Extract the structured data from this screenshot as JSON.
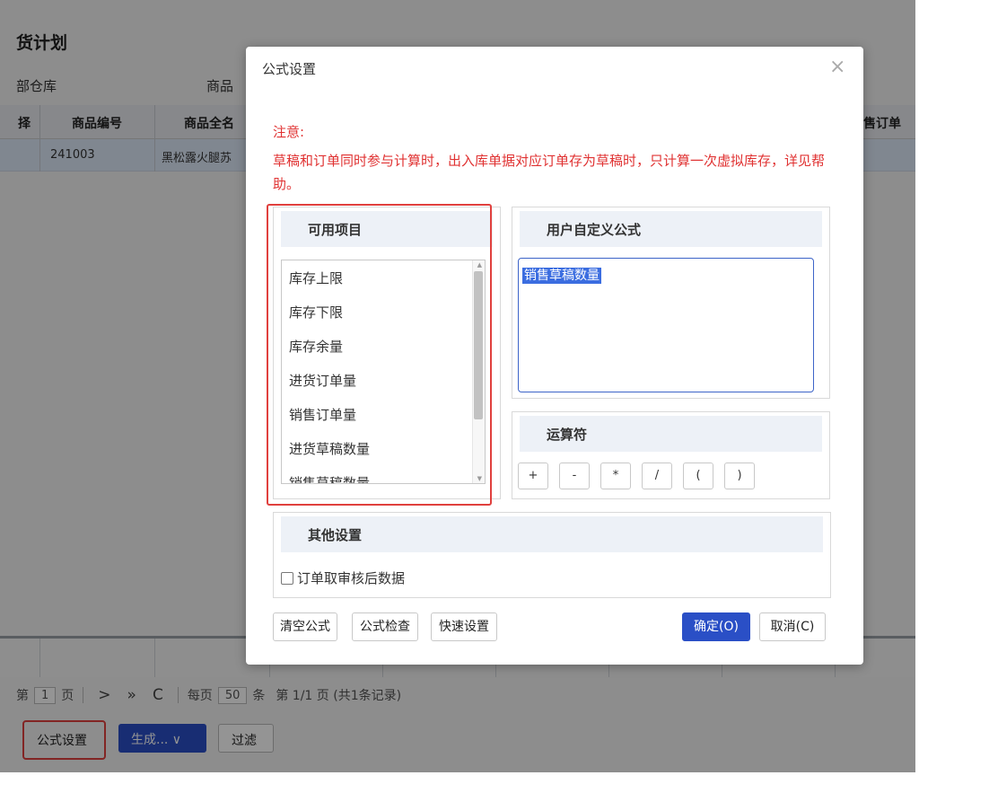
{
  "background": {
    "page_title": "货计划",
    "filter_label_1": "部仓库",
    "filter_label_2": "商品",
    "table": {
      "columns": [
        "择",
        "商品编号",
        "商品全名",
        "售订单"
      ],
      "rows": [
        [
          "241003",
          "黑松露火腿苏"
        ]
      ]
    },
    "pager": {
      "prefix": "第",
      "page": "1",
      "page_unit": "页",
      "next": ">",
      "last": "»",
      "refresh": "C",
      "per_page_label": "每页",
      "per_page": "50",
      "per_page_unit": "条",
      "summary": "第 1/1 页 (共1条记录)"
    },
    "buttons": {
      "formula_settings": "公式设置",
      "generate": "生成... ∨",
      "filter": "过滤"
    }
  },
  "modal": {
    "title": "公式设置",
    "close": "×",
    "notice_heading": "注意:",
    "notice_text": "草稿和订单同时参与计算时，出入库单据对应订单存为草稿时，只计算一次虚拟库存，详见帮助。",
    "available": {
      "heading": "可用项目",
      "items": [
        "库存上限",
        "库存下限",
        "库存余量",
        "进货订单量",
        "销售订单量",
        "进货草稿数量",
        "销售草稿数量"
      ]
    },
    "formula": {
      "heading": "用户自定义公式",
      "value": "销售草稿数量"
    },
    "operators": {
      "heading": "运算符",
      "items": [
        "+",
        "-",
        "*",
        "/",
        "(",
        ")"
      ]
    },
    "other": {
      "heading": "其他设置",
      "checkbox_label": "订单取审核后数据",
      "checked": false
    },
    "footer": {
      "clear": "清空公式",
      "check": "公式检查",
      "quick": "快速设置",
      "ok": "确定(O)",
      "cancel": "取消(C)"
    }
  },
  "colors": {
    "primary": "#2a4fc6",
    "notice_red": "#e03232",
    "highlight_frame": "#e0403e"
  }
}
